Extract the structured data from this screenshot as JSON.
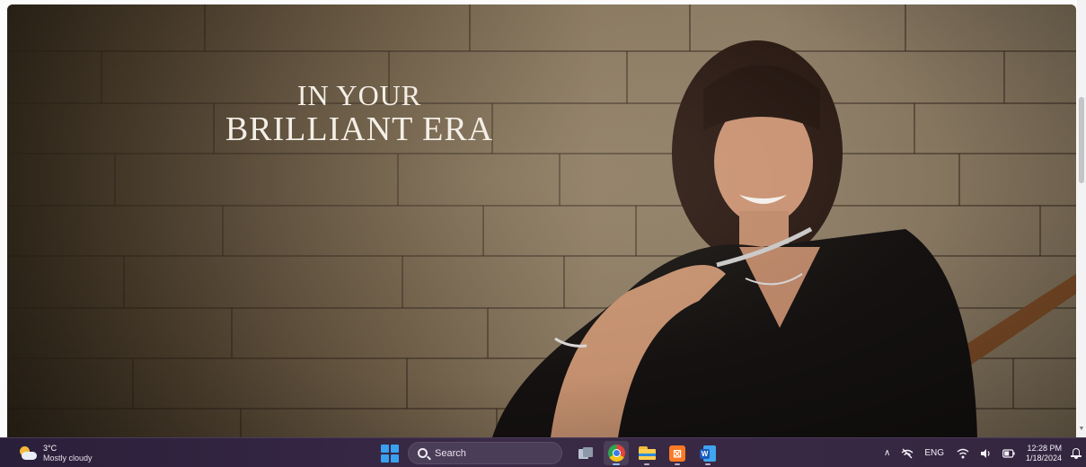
{
  "hero": {
    "headline_line1": "IN YOUR",
    "headline_line2": "BRILLIANT ERA"
  },
  "taskbar": {
    "weather": {
      "temperature": "3°C",
      "condition": "Mostly cloudy",
      "icon": "partly-cloudy-icon"
    },
    "search": {
      "label": "Search"
    },
    "pinned_apps": [
      {
        "name": "Task View",
        "icon": "task-view-icon"
      },
      {
        "name": "Google Chrome",
        "icon": "chrome-icon",
        "active": true
      },
      {
        "name": "File Explorer",
        "icon": "folder-icon"
      },
      {
        "name": "XAMPP",
        "icon": "xampp-icon",
        "glyph": "⊠"
      },
      {
        "name": "Microsoft Word",
        "icon": "word-icon",
        "glyph": "W"
      }
    ],
    "tray": {
      "show_hidden_glyph": "∧",
      "language": "ENG",
      "time": "12:28 PM",
      "date": "1/18/2024"
    }
  },
  "colors": {
    "taskbar_bg": "#34263f",
    "start_blue": "#3aa0f0",
    "headline_text": "#f4efe6"
  }
}
